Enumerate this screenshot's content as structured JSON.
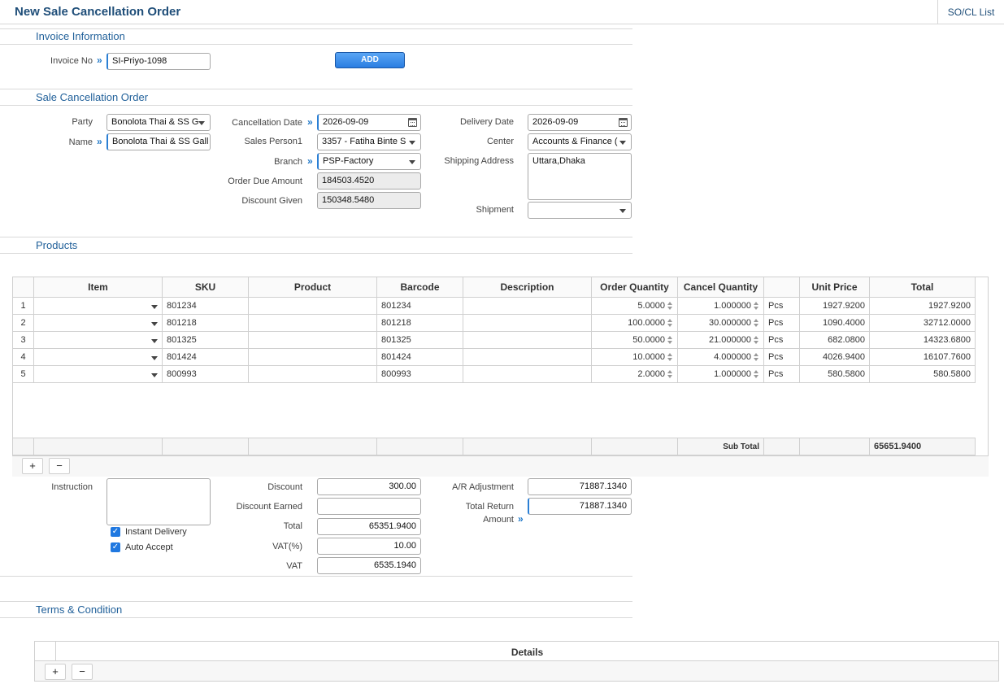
{
  "header": {
    "title": "New Sale Cancellation Order",
    "list_link": "SO/CL List"
  },
  "invoice_section": {
    "title": "Invoice Information",
    "invoice_no_label": "Invoice No",
    "invoice_no_value": "SI-Priyo-1098",
    "add_button": "ADD"
  },
  "order_section": {
    "title": "Sale Cancellation Order",
    "party_label": "Party",
    "party_value": "Bonolota Thai & SS G",
    "name_label": "Name",
    "name_value": "Bonolota Thai & SS Gall",
    "cancellation_date_label": "Cancellation Date",
    "cancellation_date_value": "2026-09-09",
    "sales_person_label": "Sales Person1",
    "sales_person_value": "3357 - Fatiha Binte S",
    "branch_label": "Branch",
    "branch_value": "PSP-Factory",
    "order_due_label": "Order Due Amount",
    "order_due_value": "184503.4520",
    "discount_given_label": "Discount Given",
    "discount_given_value": "150348.5480",
    "delivery_date_label": "Delivery Date",
    "delivery_date_value": "2026-09-09",
    "center_label": "Center",
    "center_value": "Accounts & Finance (",
    "shipping_label": "Shipping Address",
    "shipping_value": "Uttara,Dhaka",
    "shipment_label": "Shipment",
    "shipment_value": ""
  },
  "products_section": {
    "title": "Products",
    "columns": [
      "Item",
      "SKU",
      "Product",
      "Barcode",
      "Description",
      "Order Quantity",
      "Cancel Quantity",
      "",
      "Unit Price",
      "Total"
    ],
    "rows": [
      {
        "no": "1",
        "sku": "801234",
        "product": "",
        "barcode": "801234",
        "description": "",
        "order_qty": "5.0000",
        "cancel_qty": "1.000000",
        "unit": "Pcs",
        "unit_price": "1927.9200",
        "total": "1927.9200"
      },
      {
        "no": "2",
        "sku": "801218",
        "product": "",
        "barcode": "801218",
        "description": "",
        "order_qty": "100.0000",
        "cancel_qty": "30.000000",
        "unit": "Pcs",
        "unit_price": "1090.4000",
        "total": "32712.0000"
      },
      {
        "no": "3",
        "sku": "801325",
        "product": "",
        "barcode": "801325",
        "description": "",
        "order_qty": "50.0000",
        "cancel_qty": "21.000000",
        "unit": "Pcs",
        "unit_price": "682.0800",
        "total": "14323.6800"
      },
      {
        "no": "4",
        "sku": "801424",
        "product": "",
        "barcode": "801424",
        "description": "",
        "order_qty": "10.0000",
        "cancel_qty": "4.000000",
        "unit": "Pcs",
        "unit_price": "4026.9400",
        "total": "16107.7600"
      },
      {
        "no": "5",
        "sku": "800993",
        "product": "",
        "barcode": "800993",
        "description": "",
        "order_qty": "2.0000",
        "cancel_qty": "1.000000",
        "unit": "Pcs",
        "unit_price": "580.5800",
        "total": "580.5800"
      }
    ],
    "subtotal_label": "Sub Total",
    "subtotal_value": "65651.9400",
    "add_row": "+",
    "remove_row": "−"
  },
  "summary": {
    "instruction_label": "Instruction",
    "instruction_value": "",
    "instant_delivery_label": "Instant Delivery",
    "auto_accept_label": "Auto Accept",
    "discount_label": "Discount",
    "discount_value": "300.00",
    "discount_earned_label": "Discount Earned",
    "discount_earned_value": "",
    "total_label": "Total",
    "total_value": "65351.9400",
    "vat_pct_label": "VAT(%)",
    "vat_pct_value": "10.00",
    "vat_label": "VAT",
    "vat_value": "6535.1940",
    "ar_label": "A/R Adjustment",
    "ar_value": "71887.1340",
    "total_return_label_1": "Total Return",
    "total_return_label_2": "Amount",
    "total_return_value": "71887.1340"
  },
  "terms_section": {
    "title": "Terms & Condition",
    "details_column": "Details",
    "add_row": "+",
    "remove_row": "−"
  }
}
